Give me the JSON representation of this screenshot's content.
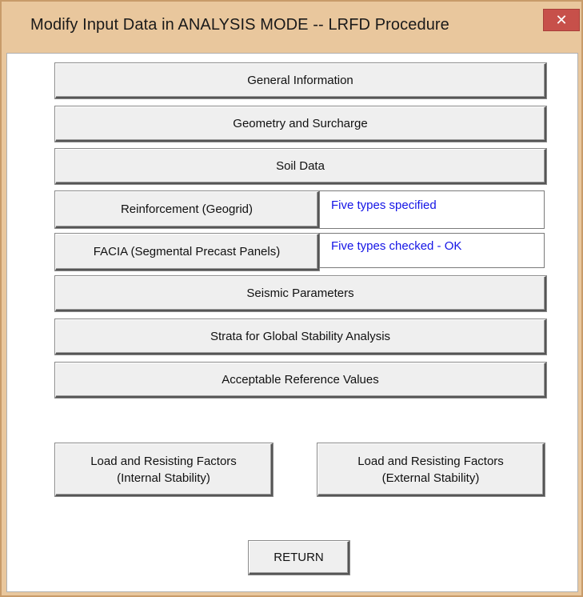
{
  "window": {
    "title": "Modify Input Data in ANALYSIS MODE -- LRFD Procedure",
    "close_glyph": "✕",
    "close_icon": "close-icon"
  },
  "buttons": {
    "general_information": "General Information",
    "geometry_surcharge": "Geometry and Surcharge",
    "soil_data": "Soil Data",
    "reinforcement": "Reinforcement (Geogrid)",
    "facia": "FACIA  (Segmental Precast Panels)",
    "seismic": "Seismic Parameters",
    "strata": "Strata for Global Stability Analysis",
    "acceptable": "Acceptable Reference Values",
    "load_internal_line1": "Load and Resisting Factors",
    "load_internal_line2": "(Internal Stability)",
    "load_external_line1": "Load and Resisting Factors",
    "load_external_line2": "(External Stability)",
    "return": "RETURN"
  },
  "status": {
    "reinforcement": "Five types specified",
    "facia": "Five types checked - OK"
  },
  "colors": {
    "titlebar": "#e9c79d",
    "close": "#c7504a",
    "status_text": "#1414e6"
  }
}
